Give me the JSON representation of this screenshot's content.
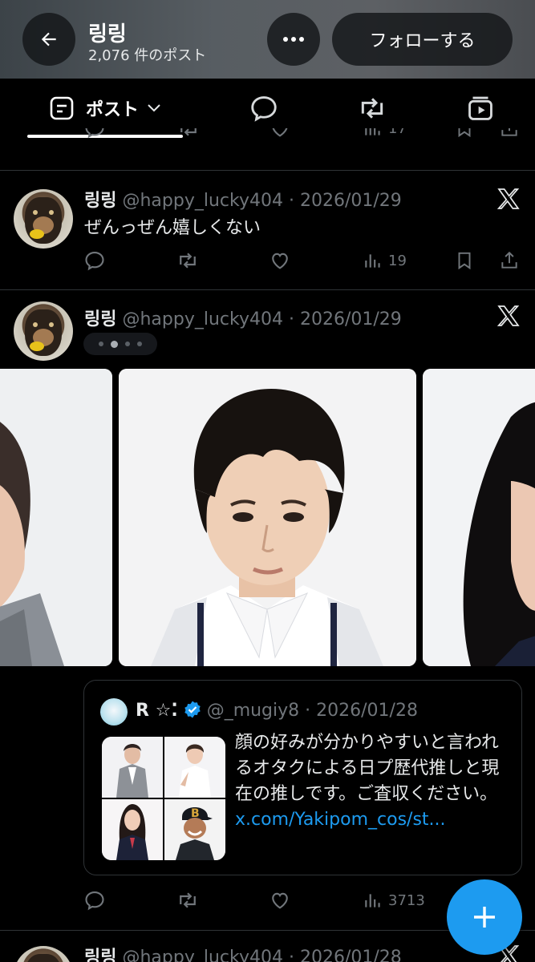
{
  "header": {
    "title": "링링",
    "post_count": "2,076 件のポスト",
    "follow_label": "フォローする"
  },
  "tabs": {
    "posts_label": "ポスト"
  },
  "posts": [
    {
      "name": "링링",
      "handle": "@happy_lucky404",
      "date": "· 2026/01/29",
      "text": "ぜんっぜん嬉しくない",
      "views": "19"
    },
    {
      "name": "링링",
      "handle": "@happy_lucky404",
      "date": "· 2026/01/29",
      "media_count_dots": 5,
      "active_dot": 2,
      "views": "3713",
      "quote": {
        "name": "R ☆⁚",
        "handle": "@_mugiy8",
        "date": "· 2026/01/28",
        "text": "顔の好みが分かりやすいと言われるオタクによる日プ歴代推しと現在の推しです。ご査収ください。 ",
        "link": "x.com/Yakipom_cos/st..."
      }
    },
    {
      "name": "링링",
      "handle": "@happy_lucky404",
      "date": "· 2026/01/28"
    }
  ],
  "partial_top_views": "17",
  "colors": {
    "accent": "#1d9bf0",
    "muted": "#71767b",
    "text": "#e7e9ea",
    "divider": "#2f3336"
  }
}
